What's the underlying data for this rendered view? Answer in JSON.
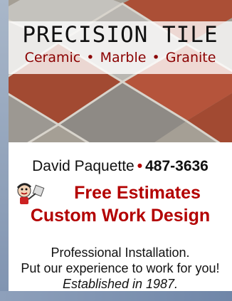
{
  "header": {
    "title": "PRECISION TILE",
    "materials": [
      "Ceramic",
      "Marble",
      "Granite"
    ],
    "separator": "•"
  },
  "contact": {
    "name": "David Paquette",
    "separator": "•",
    "phone": "487-3636"
  },
  "offers": {
    "line1": "Free Estimates",
    "line2": "Custom Work Design"
  },
  "body": {
    "installation": "Professional Installation.",
    "experience": "Put our experience to work for you!",
    "established": "Established in 1987."
  },
  "colors": {
    "accent_red": "#b30000",
    "subtitle_red": "#8a0000",
    "text": "#111111",
    "border": "#7f93b0"
  },
  "icons": {
    "mascot": "cartoon-character-icon"
  }
}
